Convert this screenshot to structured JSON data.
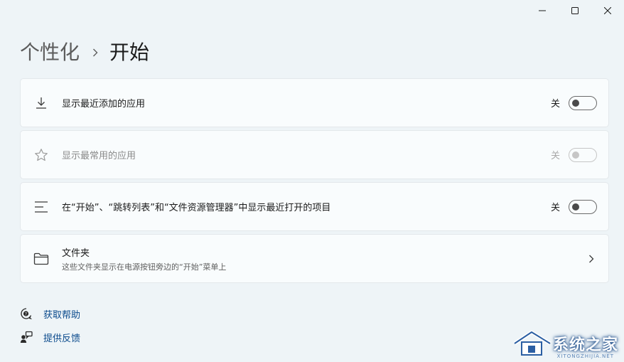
{
  "window": {
    "minimize_icon": "minimize-icon",
    "maximize_icon": "maximize-icon",
    "close_icon": "close-icon"
  },
  "breadcrumb": {
    "parent": "个性化",
    "current": "开始"
  },
  "settings": [
    {
      "icon": "download-icon",
      "title": "显示最近添加的应用",
      "state_label": "关",
      "enabled": true,
      "toggle_on": false
    },
    {
      "icon": "star-icon",
      "title": "显示最常用的应用",
      "state_label": "关",
      "enabled": false,
      "toggle_on": false
    },
    {
      "icon": "list-icon",
      "title": "在“开始”、“跳转列表”和“文件资源管理器”中显示最近打开的项目",
      "state_label": "关",
      "enabled": true,
      "toggle_on": false
    },
    {
      "icon": "folder-icon",
      "title": "文件夹",
      "subtitle": "这些文件夹显示在电源按钮旁边的“开始”菜单上"
    }
  ],
  "links": [
    {
      "icon": "help-icon",
      "label": "获取帮助"
    },
    {
      "icon": "feedback-icon",
      "label": "提供反馈"
    }
  ],
  "watermark": {
    "text": "系统之家",
    "url": "XITONGZHIJIA.NET"
  },
  "colors": {
    "background": "#eef4f7",
    "card": "#f9fcfd",
    "link": "#0a4a8c"
  }
}
